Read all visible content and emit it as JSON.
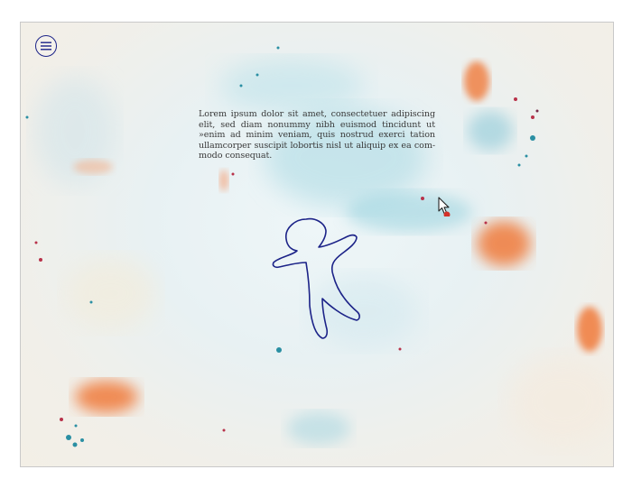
{
  "menu": {
    "icon": "hamburger-menu-icon"
  },
  "content": {
    "paragraph": "Lorem ipsum dolor sit amet, consectetuer adipiscing elit, sed diam nonummy nibh euismod tincidunt ut »enim ad minim veniam, quis nostrud exerci tation ullamcorper suscipit lobortis nisl ut aliquip ex ea com-modo consequat."
  },
  "illustration": {
    "icon": "person-outline-icon",
    "color": "#1c2388"
  },
  "pointer": {
    "icon": "mouse-cursor-icon"
  },
  "colors": {
    "accent": "#1c2388",
    "splash_orange": "#f07a3a",
    "splash_teal": "#5fb8c9"
  }
}
